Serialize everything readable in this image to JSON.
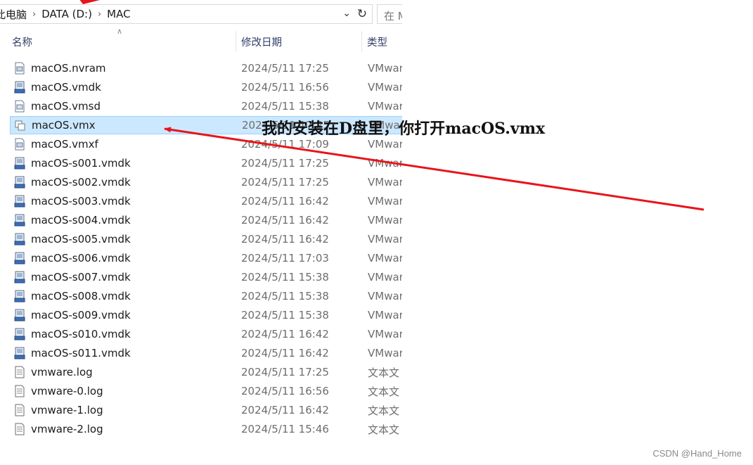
{
  "address": {
    "breadcrumbs": [
      "此电脑",
      "DATA (D:)",
      "MAC"
    ],
    "search_placeholder": "在 M"
  },
  "columns": {
    "name": "名称",
    "date": "修改日期",
    "type": "类型"
  },
  "files": [
    {
      "name": "macOS.nvram",
      "date": "2024/5/11 17:25",
      "type": "VMwar",
      "icon": "nvram-file-icon"
    },
    {
      "name": "macOS.vmdk",
      "date": "2024/5/11 16:56",
      "type": "VMwar",
      "icon": "disk-file-icon"
    },
    {
      "name": "macOS.vmsd",
      "date": "2024/5/11 15:38",
      "type": "VMwar",
      "icon": "vmsd-file-icon"
    },
    {
      "name": "macOS.vmx",
      "date": "2024/5/11 17:25",
      "type": "VMwar",
      "icon": "vmx-file-icon"
    },
    {
      "name": "macOS.vmxf",
      "date": "2024/5/11 17:09",
      "type": "VMwar",
      "icon": "vmxf-file-icon"
    },
    {
      "name": "macOS-s001.vmdk",
      "date": "2024/5/11 17:25",
      "type": "VMwar",
      "icon": "disk-file-icon"
    },
    {
      "name": "macOS-s002.vmdk",
      "date": "2024/5/11 17:25",
      "type": "VMwar",
      "icon": "disk-file-icon"
    },
    {
      "name": "macOS-s003.vmdk",
      "date": "2024/5/11 16:42",
      "type": "VMwar",
      "icon": "disk-file-icon"
    },
    {
      "name": "macOS-s004.vmdk",
      "date": "2024/5/11 16:42",
      "type": "VMwar",
      "icon": "disk-file-icon"
    },
    {
      "name": "macOS-s005.vmdk",
      "date": "2024/5/11 16:42",
      "type": "VMwar",
      "icon": "disk-file-icon"
    },
    {
      "name": "macOS-s006.vmdk",
      "date": "2024/5/11 17:03",
      "type": "VMwar",
      "icon": "disk-file-icon"
    },
    {
      "name": "macOS-s007.vmdk",
      "date": "2024/5/11 15:38",
      "type": "VMwar",
      "icon": "disk-file-icon"
    },
    {
      "name": "macOS-s008.vmdk",
      "date": "2024/5/11 15:38",
      "type": "VMwar",
      "icon": "disk-file-icon"
    },
    {
      "name": "macOS-s009.vmdk",
      "date": "2024/5/11 15:38",
      "type": "VMwar",
      "icon": "disk-file-icon"
    },
    {
      "name": "macOS-s010.vmdk",
      "date": "2024/5/11 16:42",
      "type": "VMwar",
      "icon": "disk-file-icon"
    },
    {
      "name": "macOS-s011.vmdk",
      "date": "2024/5/11 16:42",
      "type": "VMwar",
      "icon": "disk-file-icon"
    },
    {
      "name": "vmware.log",
      "date": "2024/5/11 17:25",
      "type": "文本文",
      "icon": "text-file-icon"
    },
    {
      "name": "vmware-0.log",
      "date": "2024/5/11 16:56",
      "type": "文本文",
      "icon": "text-file-icon"
    },
    {
      "name": "vmware-1.log",
      "date": "2024/5/11 16:42",
      "type": "文本文",
      "icon": "text-file-icon"
    },
    {
      "name": "vmware-2.log",
      "date": "2024/5/11 15:46",
      "type": "文本文",
      "icon": "text-file-icon"
    }
  ],
  "selected_file": "macOS.vmx",
  "annotation_text": "我的安装在D盘里，你打开macOS.vmx",
  "watermark": "CSDN @Hand_Home",
  "colors": {
    "arrow": "#e8141b",
    "selection": "#cce8ff",
    "header_text": "#34406b"
  }
}
